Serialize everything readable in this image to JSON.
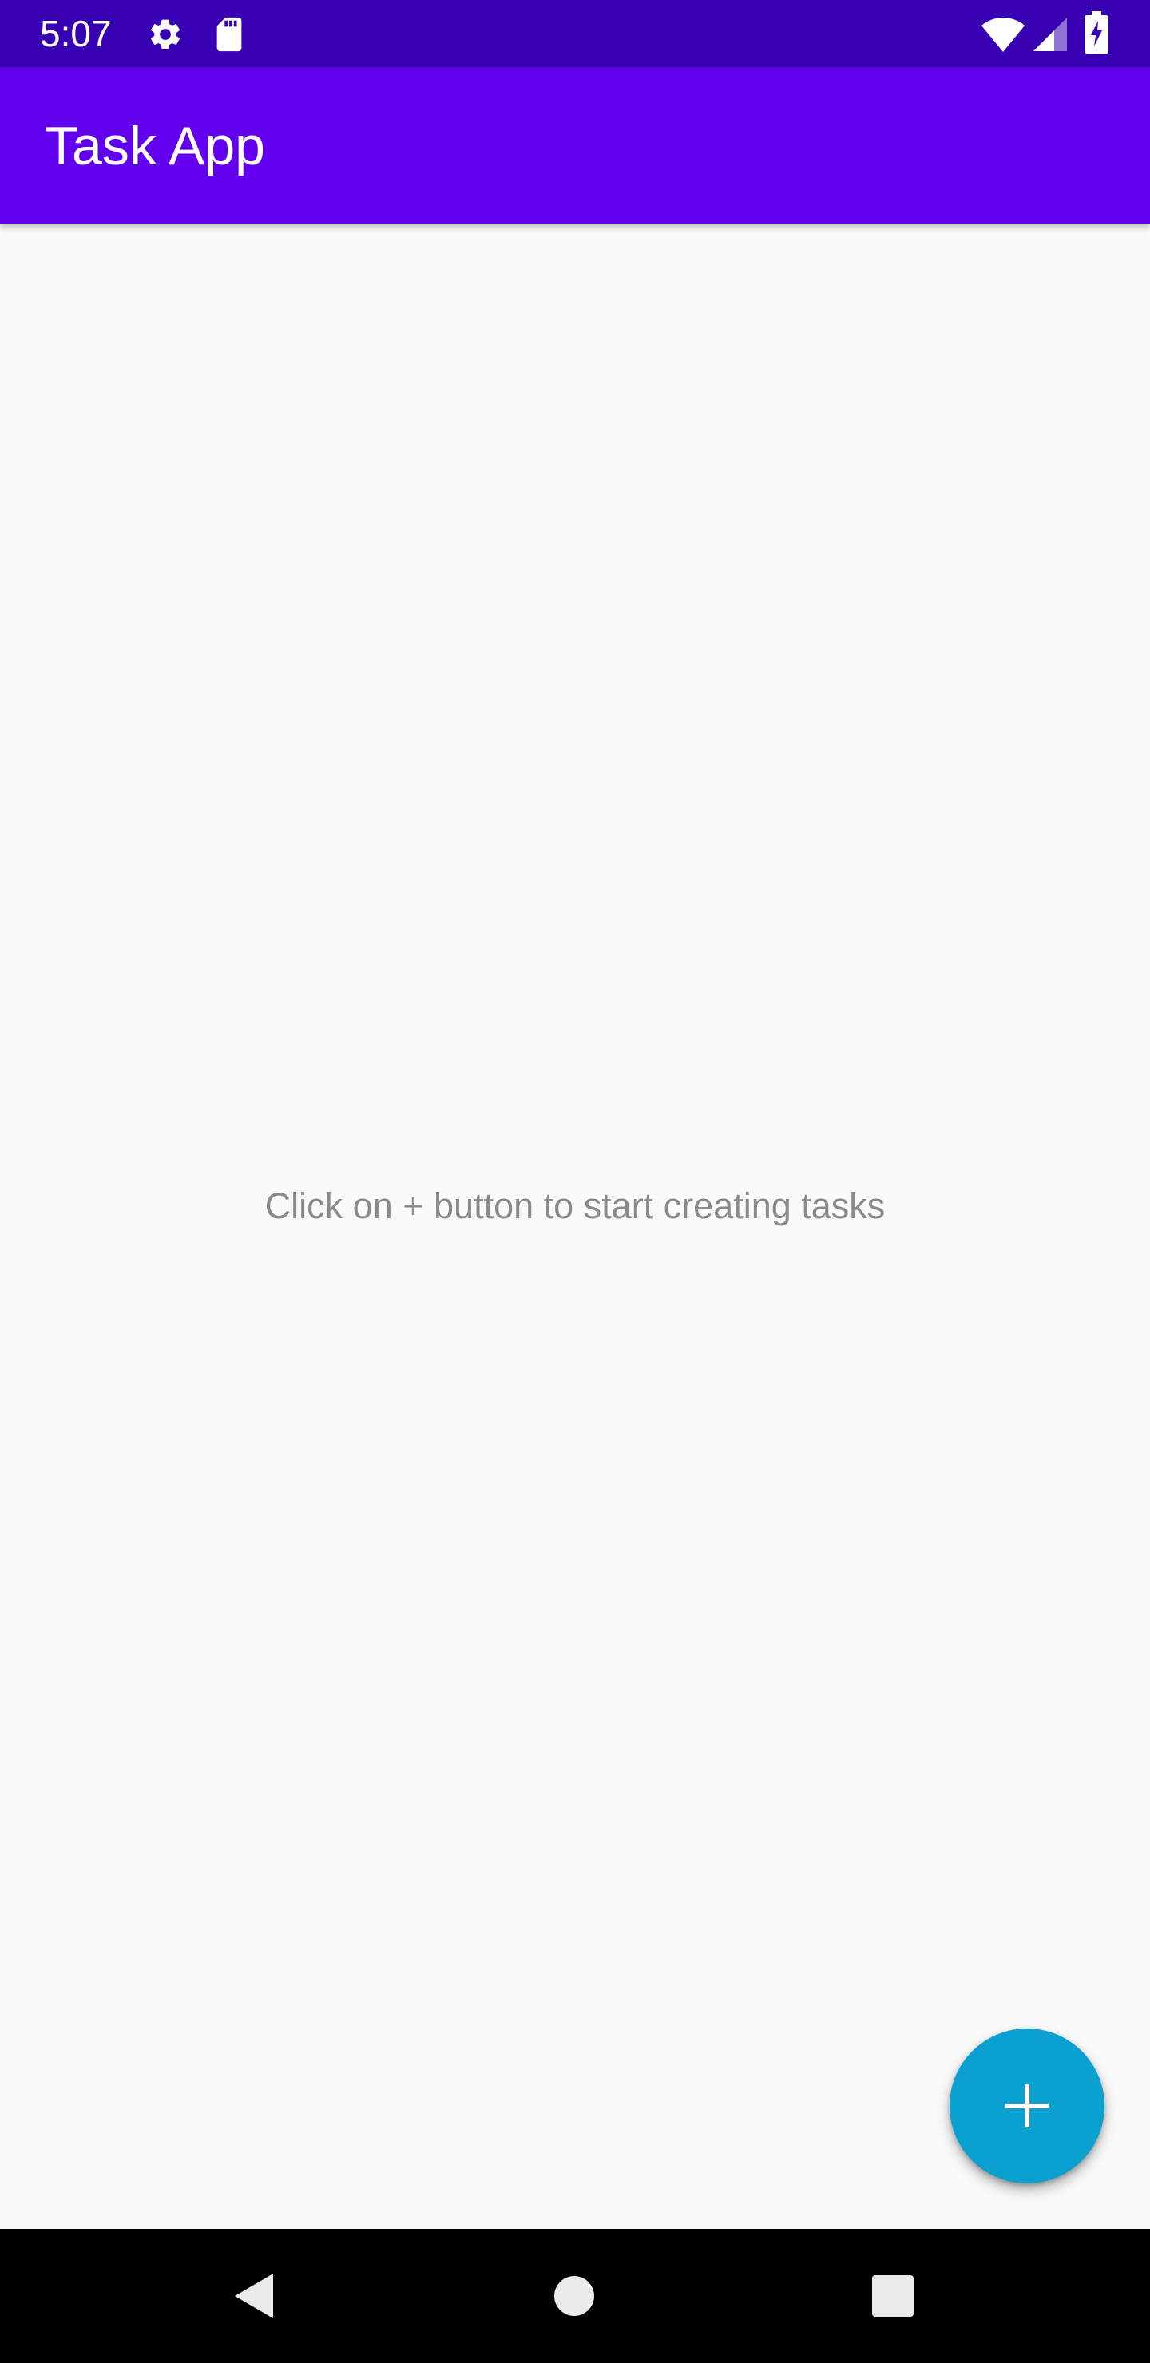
{
  "status_bar": {
    "time": "5:07",
    "background": "#3700B3",
    "icons": [
      "gear-icon",
      "sd-card-icon",
      "wifi-icon",
      "signal-icon",
      "battery-charging-icon"
    ]
  },
  "app_bar": {
    "title": "Task App",
    "background": "#6200EE"
  },
  "content": {
    "empty_message": "Click on + button to start creating tasks"
  },
  "fab": {
    "icon": "plus-icon",
    "background": "#0AA0D0"
  },
  "nav_bar": {
    "buttons": [
      "back-icon",
      "home-icon",
      "recents-icon"
    ]
  }
}
